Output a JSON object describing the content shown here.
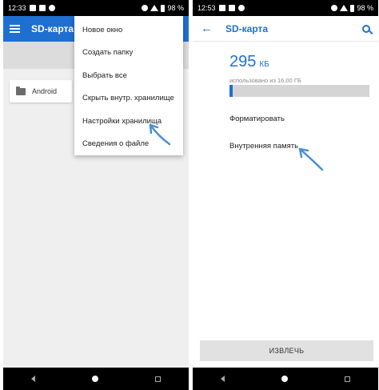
{
  "left_screen": {
    "status": {
      "time": "12:33",
      "battery": "98 %"
    },
    "appbar": {
      "title": "SD-карта"
    },
    "folder": {
      "name": "Android"
    },
    "menu": [
      "Новое окно",
      "Создать папку",
      "Выбрать все",
      "Скрыть внутр. хранилище",
      "Настройки хранилища",
      "Сведения о файле"
    ]
  },
  "right_screen": {
    "status": {
      "time": "12:53",
      "battery": "98 %"
    },
    "appbar": {
      "title": "SD-карта"
    },
    "storage": {
      "amount": "295",
      "unit": "КБ",
      "caption": "использовано из 16,00 ГБ",
      "used_fraction": 0.02
    },
    "prefs": {
      "format": "Форматировать",
      "internal": "Внутренняя память"
    },
    "eject_button": "ИЗВЛЕЧЬ"
  },
  "colors": {
    "accent": "#1f6fd1",
    "annotation_arrow": "#4a90d6"
  }
}
